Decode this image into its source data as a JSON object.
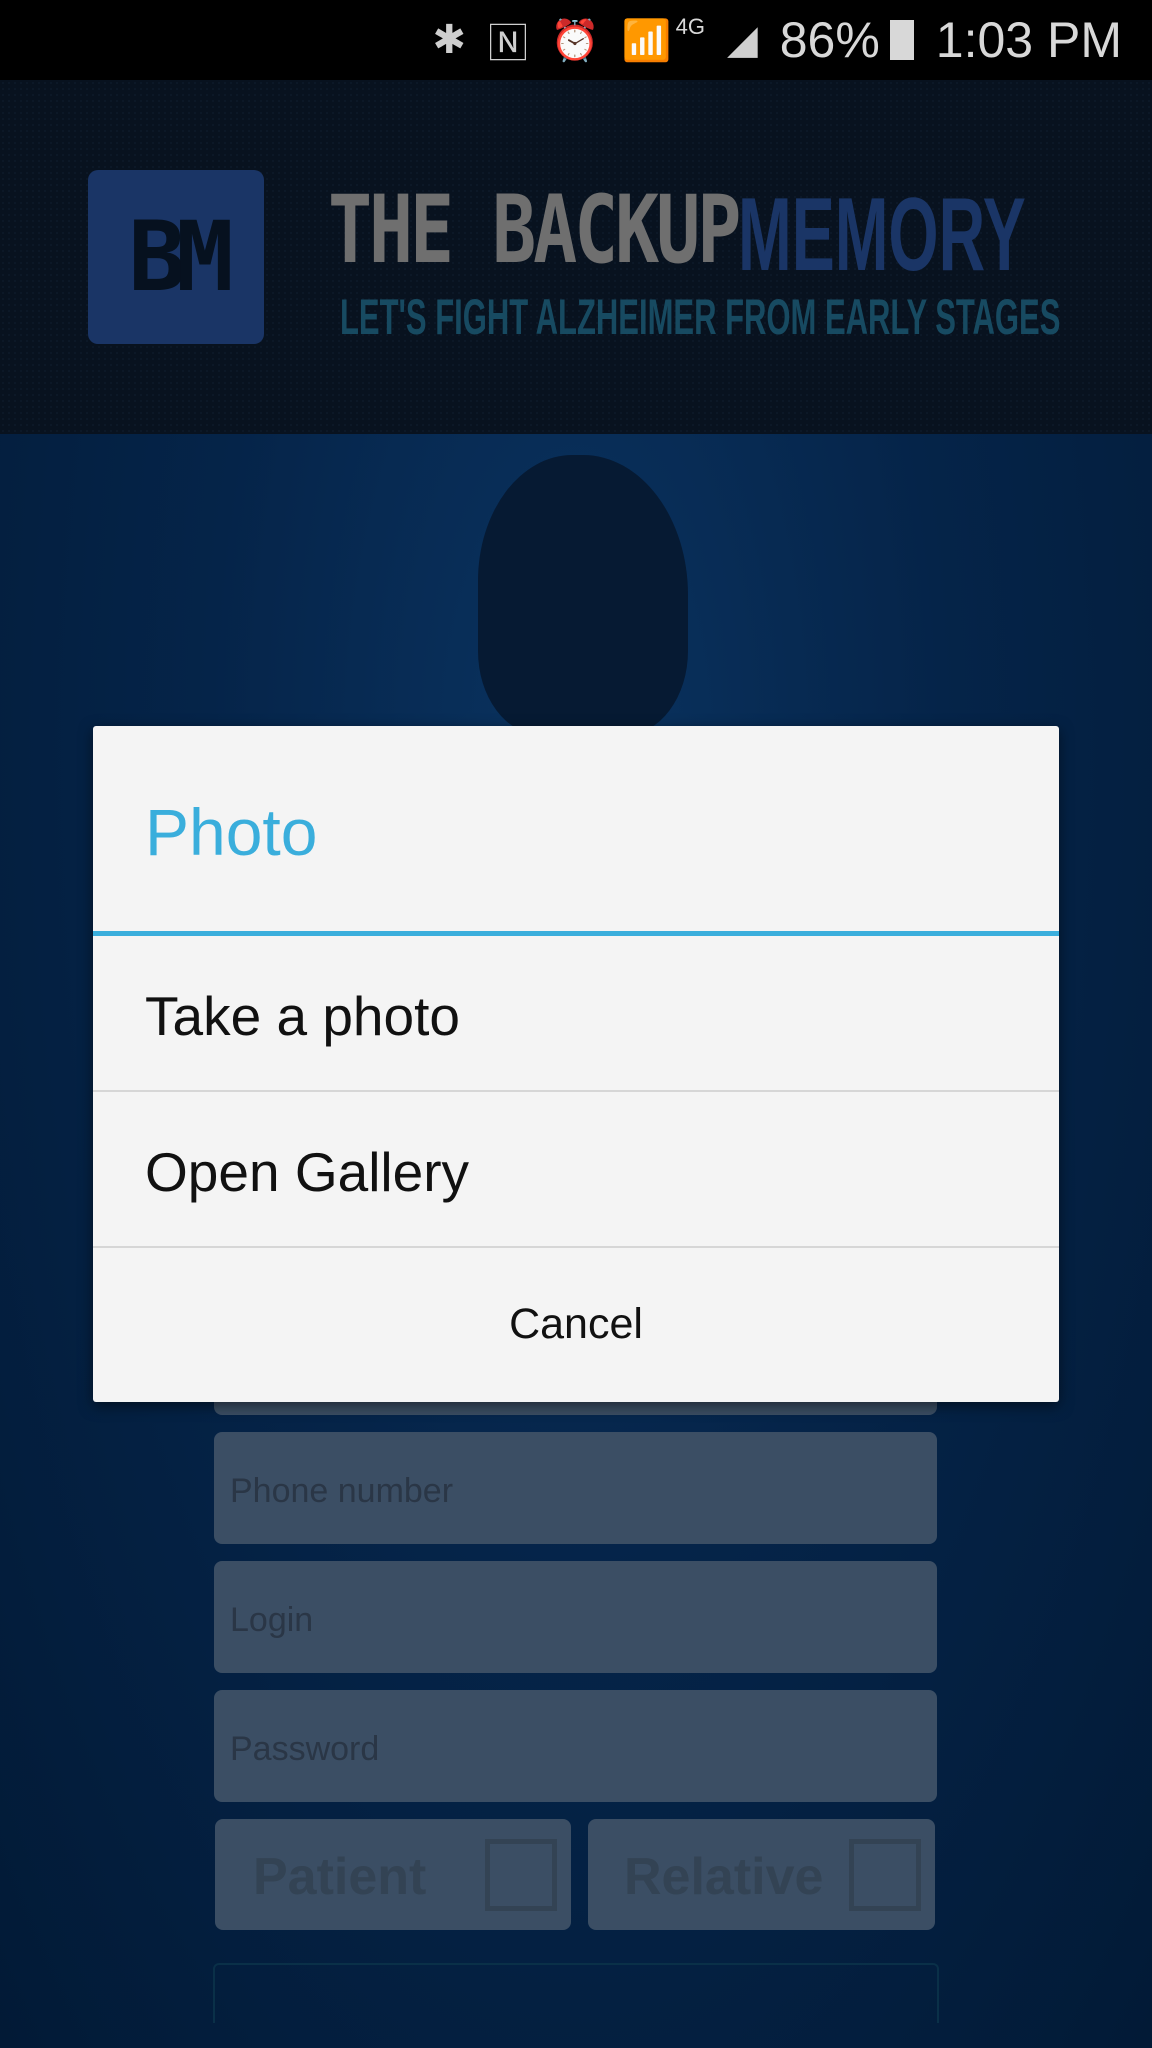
{
  "status_bar": {
    "battery": "86%",
    "time": "1:03 PM",
    "network": "4G",
    "icons": [
      "bluetooth-icon",
      "nfc-icon",
      "alarm-icon",
      "wifi-icon",
      "signal-icon",
      "battery-icon"
    ]
  },
  "header": {
    "logo": "BM",
    "title_part1": "THE BACKUP",
    "title_part2": "MEMORY",
    "subtitle": "LET'S FIGHT ALZHEIMER FROM EARLY STAGES"
  },
  "form": {
    "phone_placeholder": "Phone number",
    "login_placeholder": "Login",
    "password_placeholder": "Password",
    "patient_label": "Patient",
    "relative_label": "Relative"
  },
  "dialog": {
    "title": "Photo",
    "options": [
      "Take a photo",
      "Open Gallery"
    ],
    "cancel": "Cancel",
    "accent": "#3aaedc"
  }
}
